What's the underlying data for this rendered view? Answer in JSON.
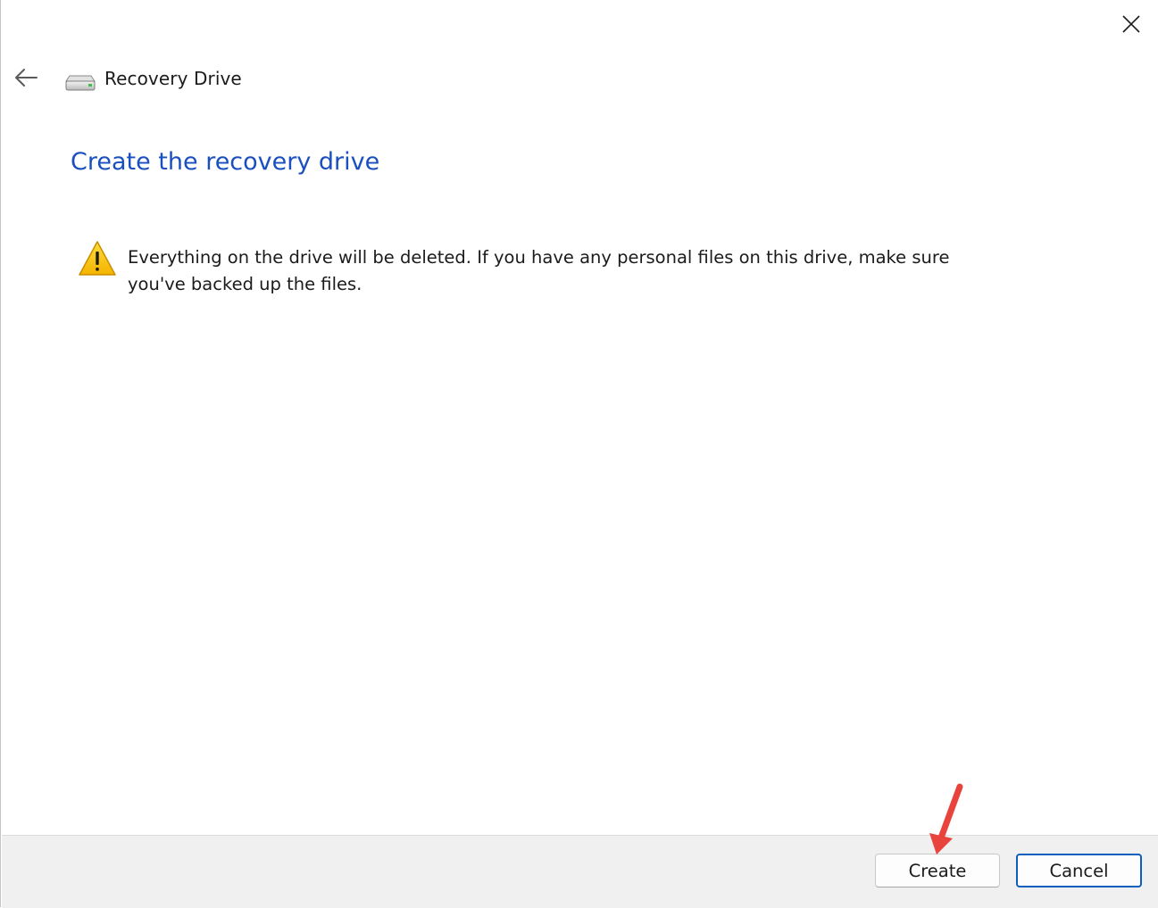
{
  "window": {
    "title": "Recovery Drive",
    "close_icon": "close-icon",
    "back_icon": "back-arrow-icon",
    "app_icon": "drive-icon"
  },
  "main": {
    "heading": "Create the recovery drive",
    "warning": {
      "icon": "warning-icon",
      "text": "Everything on the drive will be deleted. If you have any personal files on this drive, make sure you've backed up the files."
    }
  },
  "footer": {
    "create_label": "Create",
    "cancel_label": "Cancel"
  },
  "colors": {
    "heading": "#1a4fc0",
    "cancel_border": "#0a5fbf",
    "footer_bg": "#f0f0f0",
    "annotation_arrow": "#e8433c"
  }
}
